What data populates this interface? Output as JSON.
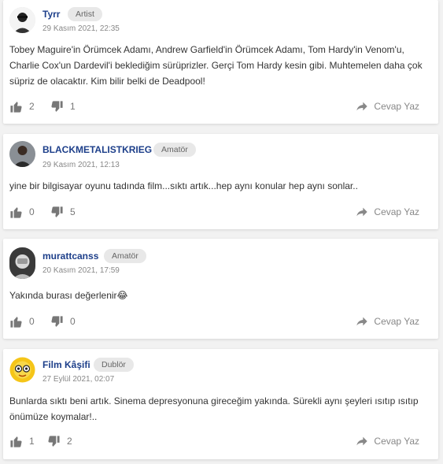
{
  "comments": [
    {
      "username": "Tyrr",
      "badge": "Artist",
      "date": "29 Kasım 2021, 22:35",
      "text": "Tobey Maguire'in Örümcek Adamı, Andrew Garfield'in Örümcek Adamı, Tom Hardy'in Venom'u, Charlie Cox'un Dardevil'i beklediğim sürüprizler. Gerçi Tom Hardy kesin gibi. Muhtemelen daha çok süpriz de olacaktır. Kim bilir belki de Deadpool!",
      "likes": "2",
      "dislikes": "1",
      "reply_label": "Cevap Yaz",
      "avatar_icon": "user-avatar-icon"
    },
    {
      "username": "BLACKMETALISTKRIEG",
      "badge": "Amatör",
      "date": "29 Kasım 2021, 12:13",
      "text": "yine bir bilgisayar oyunu tadında film...sıktı artık...hep aynı konular hep aynı sonlar..",
      "likes": "0",
      "dislikes": "5",
      "reply_label": "Cevap Yaz",
      "avatar_icon": "user-avatar-icon"
    },
    {
      "username": "murattcanss",
      "badge": "Amatör",
      "date": "20 Kasım 2021, 17:59",
      "text": "Yakında burası değerlenir😂",
      "likes": "0",
      "dislikes": "0",
      "reply_label": "Cevap Yaz",
      "avatar_icon": "user-avatar-icon"
    },
    {
      "username": "Film Kâşifi",
      "badge": "Dublör",
      "date": "27 Eylül 2021, 02:07",
      "text": "Bunlarda sıktı beni artık. Sinema depresyonuna gireceğim yakında. Sürekli aynı şeyleri ısıtıp ısıtıp önümüze koymalar!..",
      "likes": "1",
      "dislikes": "2",
      "reply_label": "Cevap Yaz",
      "avatar_icon": "user-avatar-icon"
    }
  ],
  "colors": {
    "username": "#1d3f8a",
    "badge_bg": "#e8e8e8",
    "icon": "#777777",
    "page_bg": "#f2f2f2"
  }
}
